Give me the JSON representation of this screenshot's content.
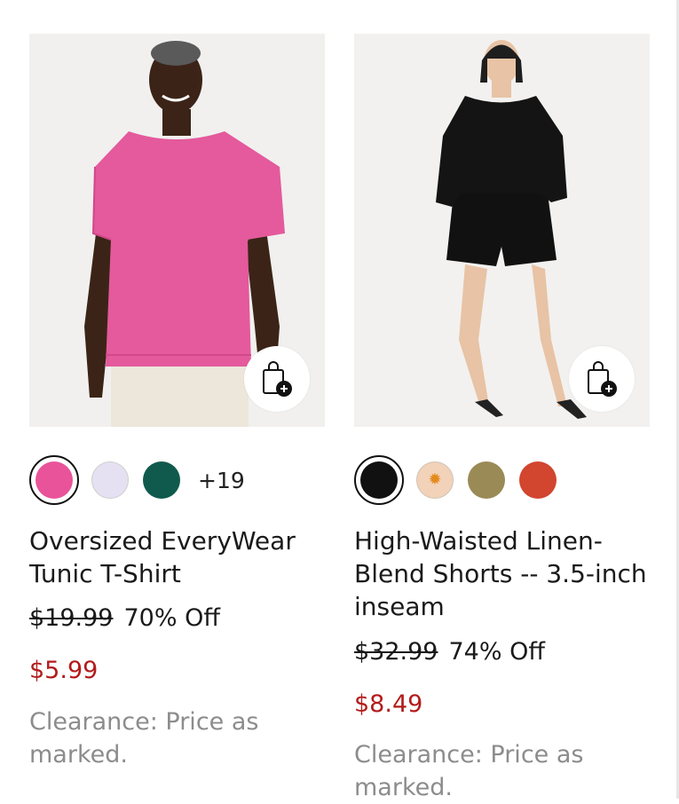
{
  "products": [
    {
      "title": "Oversized EveryWear Tunic T-Shirt",
      "original_price": "$19.99",
      "discount": "70% Off",
      "sale_price": "$5.99",
      "note": "Clearance: Price as marked.",
      "more_colors": "+19",
      "swatch_colors": [
        "#e9539a",
        "#e6e1f2",
        "#0f5a4d"
      ]
    },
    {
      "title": "High-Waisted Linen-Blend Shorts -- 3.5-inch inseam",
      "original_price": "$32.99",
      "discount": "74% Off",
      "sale_price": "$8.49",
      "note": "Clearance: Price as marked.",
      "more_colors": "",
      "swatch_colors": [
        "#111111",
        "#f2d2b8",
        "#9a8a55",
        "#d2452f"
      ]
    }
  ],
  "colors": {
    "sale_price": "#b31b1b",
    "note": "#8c8c8c",
    "text": "#1a1a1a"
  },
  "icons": {
    "add_to_bag": "shopping-bag-plus-icon"
  }
}
